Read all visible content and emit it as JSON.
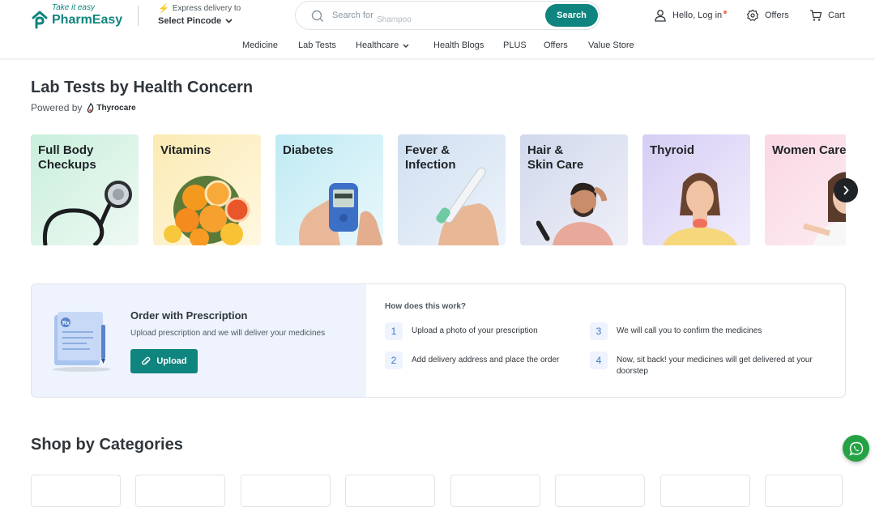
{
  "header": {
    "logo_tagline": "Take it easy",
    "logo_name": "PharmEasy",
    "delivery_label": "Express delivery to",
    "pincode_label": "Select Pincode",
    "search_placeholder": "Search for",
    "search_hint": "Shampoo",
    "search_button": "Search",
    "login_label": "Hello, Log in",
    "offers_label": "Offers",
    "cart_label": "Cart"
  },
  "nav": {
    "items": [
      {
        "label": "Medicine"
      },
      {
        "label": "Lab Tests"
      },
      {
        "label": "Healthcare"
      },
      {
        "label": "Health Blogs"
      },
      {
        "label": "PLUS"
      },
      {
        "label": "Offers"
      },
      {
        "label": "Value Store"
      }
    ]
  },
  "lab_tests": {
    "title": "Lab Tests by Health Concern",
    "powered_by": "Powered by",
    "partner_name": "Thyrocare",
    "cards": [
      {
        "label": "Full Body\nCheckups",
        "bg": "#d8f2e6"
      },
      {
        "label": "Vitamins",
        "bg": "#fdf0c8"
      },
      {
        "label": "Diabetes",
        "bg": "#cdeff5"
      },
      {
        "label": "Fever &\nInfection",
        "bg": "#d6e4f4"
      },
      {
        "label": "Hair &\nSkin Care",
        "bg": "#d8dcee"
      },
      {
        "label": "Thyroid",
        "bg": "#e2dbf7"
      },
      {
        "label": "Women Care",
        "bg": "#fbe1ea"
      }
    ]
  },
  "prescription": {
    "title": "Order with Prescription",
    "subtitle": "Upload prescription and we will deliver your medicines",
    "upload_button": "Upload",
    "how_title": "How does this work?",
    "steps": [
      {
        "num": "1",
        "text": "Upload a photo of your prescription"
      },
      {
        "num": "2",
        "text": "Add delivery address and place the order"
      },
      {
        "num": "3",
        "text": "We will call you to confirm the medicines"
      },
      {
        "num": "4",
        "text": "Now, sit back! your medicines will get delivered at your doorstep"
      }
    ]
  },
  "categories": {
    "title": "Shop by Categories"
  },
  "colors": {
    "brand": "#10847e",
    "accent_bg": "#eef3fe"
  }
}
